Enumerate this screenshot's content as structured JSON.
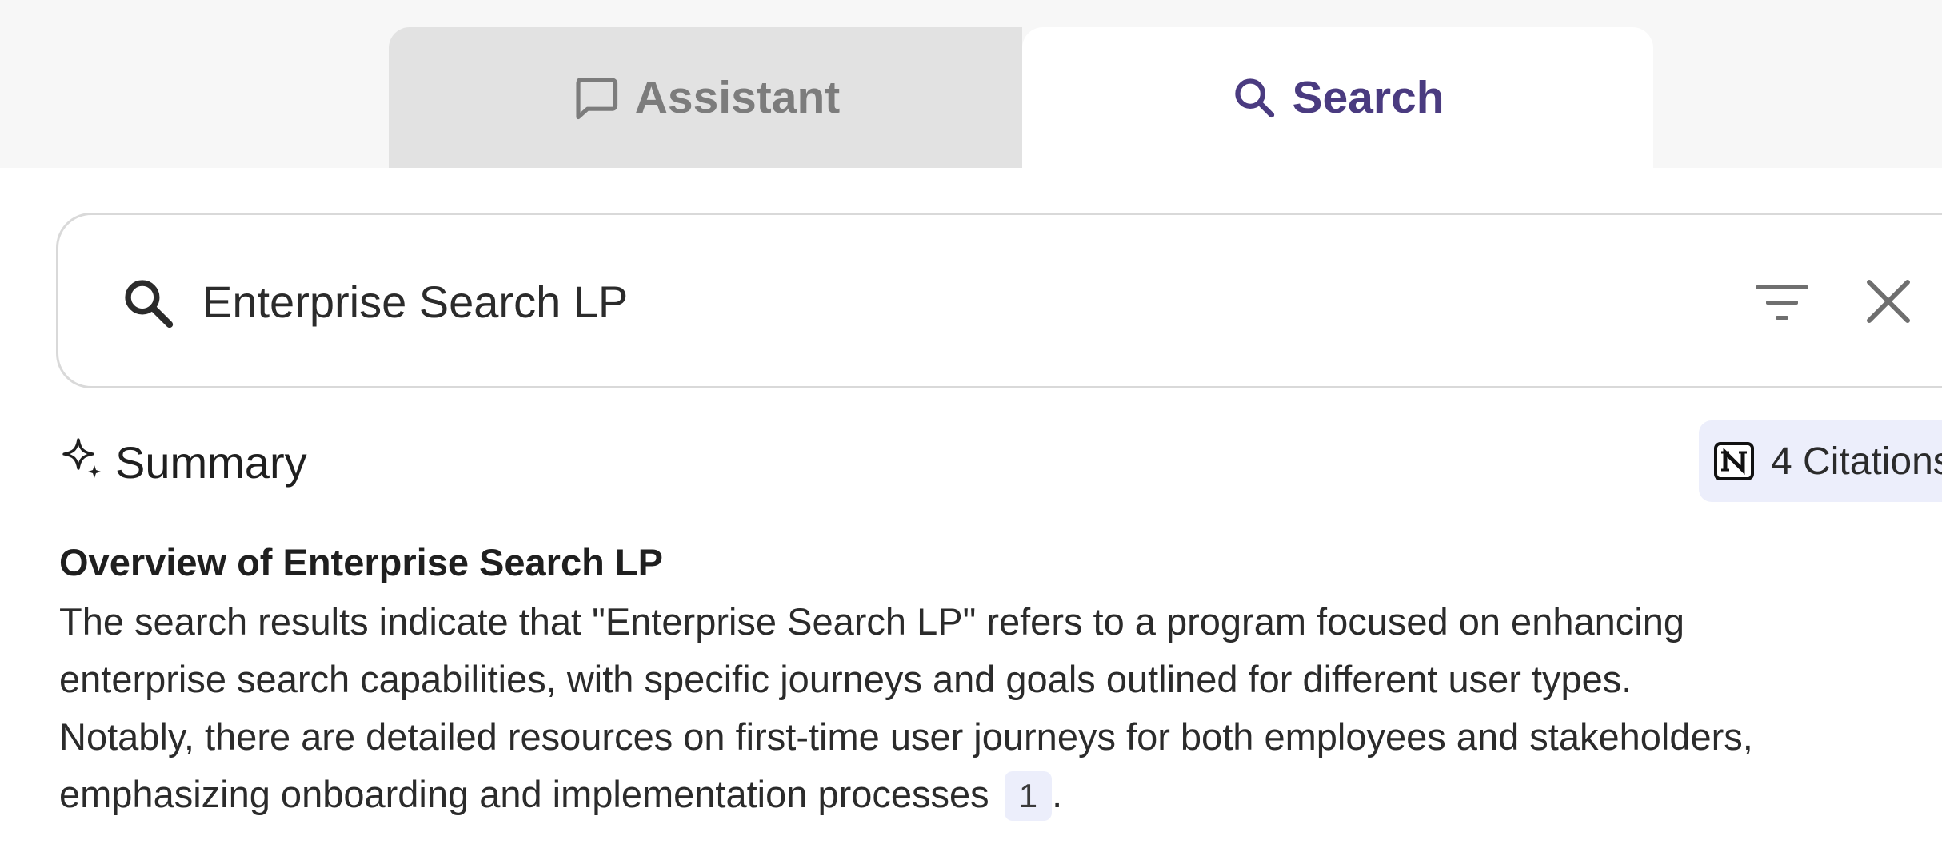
{
  "tabs": {
    "assistant_label": "Assistant",
    "search_label": "Search"
  },
  "search": {
    "query": "Enterprise Search LP"
  },
  "summary": {
    "header": "Summary",
    "citations_label": "4 Citations",
    "overview_title": "Overview of Enterprise Search LP",
    "lines": [
      "The search results indicate that \"Enterprise Search LP\" refers to a program focused on enhancing",
      "enterprise search capabilities, with specific journeys and goals outlined for different user types.",
      "Notably, there are detailed resources on first-time user journeys for both employees and stakeholders,",
      "emphasizing onboarding and implementation processes"
    ],
    "citation_marker": "1",
    "trailing": "."
  },
  "colors": {
    "active_tab_text": "#4a3b80",
    "inactive_tab_bg": "#e2e2e2",
    "badge_bg": "#eceefb"
  },
  "icons": {
    "assistant_tab": "chat-bubble-icon",
    "search_tab": "search-icon",
    "search_field": "search-icon",
    "filter": "filter-icon",
    "clear": "close-icon",
    "summary": "sparkle-icon",
    "citations_source": "notion-logo-icon"
  }
}
